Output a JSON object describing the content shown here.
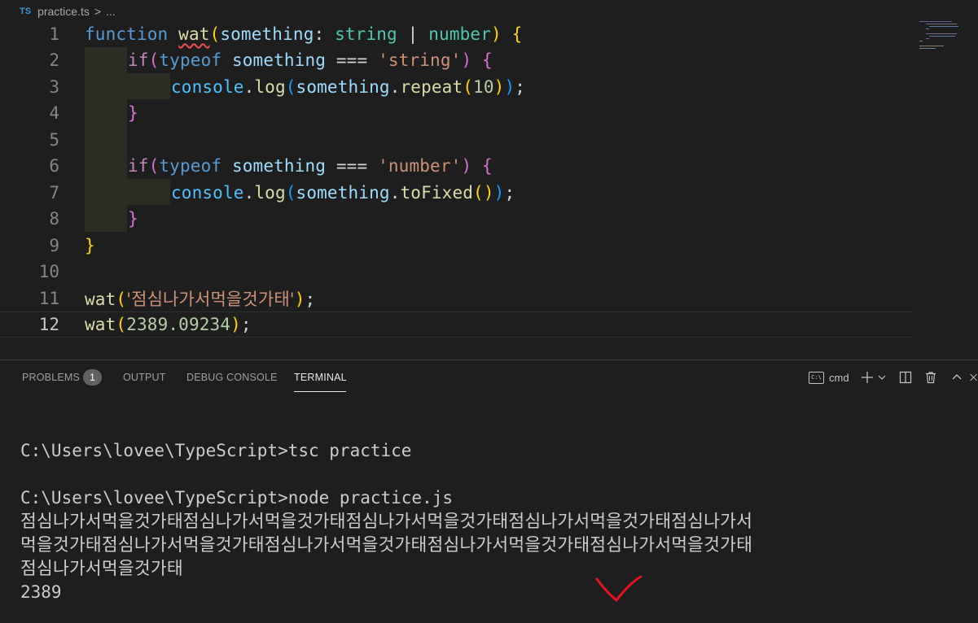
{
  "breadcrumb": {
    "file_icon": "TS",
    "file_name": "practice.ts",
    "separator": ">",
    "ellipsis": "..."
  },
  "editor": {
    "current_line": "12",
    "lines": [
      {
        "num": "1"
      },
      {
        "num": "2"
      },
      {
        "num": "3"
      },
      {
        "num": "4"
      },
      {
        "num": "5"
      },
      {
        "num": "6"
      },
      {
        "num": "7"
      },
      {
        "num": "8"
      },
      {
        "num": "9"
      },
      {
        "num": "10"
      },
      {
        "num": "11"
      },
      {
        "num": "12"
      }
    ],
    "tokens": {
      "function": "function",
      "wat": "wat",
      "something": "something",
      "colon": ":",
      "string_type": "string",
      "pipe": "|",
      "number_type": "number",
      "if": "if",
      "typeof": "typeof",
      "eqeqeq": "===",
      "str_string": "'string'",
      "str_number": "'number'",
      "console": "console",
      "log": "log",
      "repeat": "repeat",
      "ten": "10",
      "toFixed": "toFixed",
      "korean_str": "'점심나가서먹을것가태'",
      "float_num": "2389.09234",
      "dot": ".",
      "semi": ";",
      "lparen": "(",
      "rparen": ")",
      "lbrace": "{",
      "rbrace": "}"
    }
  },
  "panel": {
    "tabs": [
      {
        "label": "PROBLEMS",
        "badge": "1"
      },
      {
        "label": "OUTPUT"
      },
      {
        "label": "DEBUG CONSOLE"
      },
      {
        "label": "TERMINAL",
        "active": true
      }
    ],
    "terminal_profile": "cmd",
    "terminal_profile_icon": "C:\\",
    "controls": [
      "plus-icon",
      "chevron-down-icon",
      "split-icon",
      "trash-icon",
      "chevron-up-icon",
      "close-icon"
    ]
  },
  "terminal": {
    "lines": [
      "C:\\Users\\lovee\\TypeScript>tsc practice",
      "",
      "C:\\Users\\lovee\\TypeScript>node practice.js"
    ],
    "output_lines": [
      "점심나가서먹을것가태점심나가서먹을것가태점심나가서먹을것가태점심나가서먹을것가태점심나가서",
      "먹을것가태점심나가서먹을것가태점심나가서먹을것가태점심나가서먹을것가태점심나가서먹을것가태",
      "점심나가서먹을것가태"
    ],
    "result": "2389"
  },
  "colors": {
    "background": "#1e1e1e",
    "keyword": "#569cd6",
    "control": "#c586c0",
    "function": "#dcdcaa",
    "parameter": "#9cdcfe",
    "type": "#4ec9b0",
    "string": "#ce9178",
    "number": "#b5cea8",
    "annotation_mark": "#e81123"
  }
}
